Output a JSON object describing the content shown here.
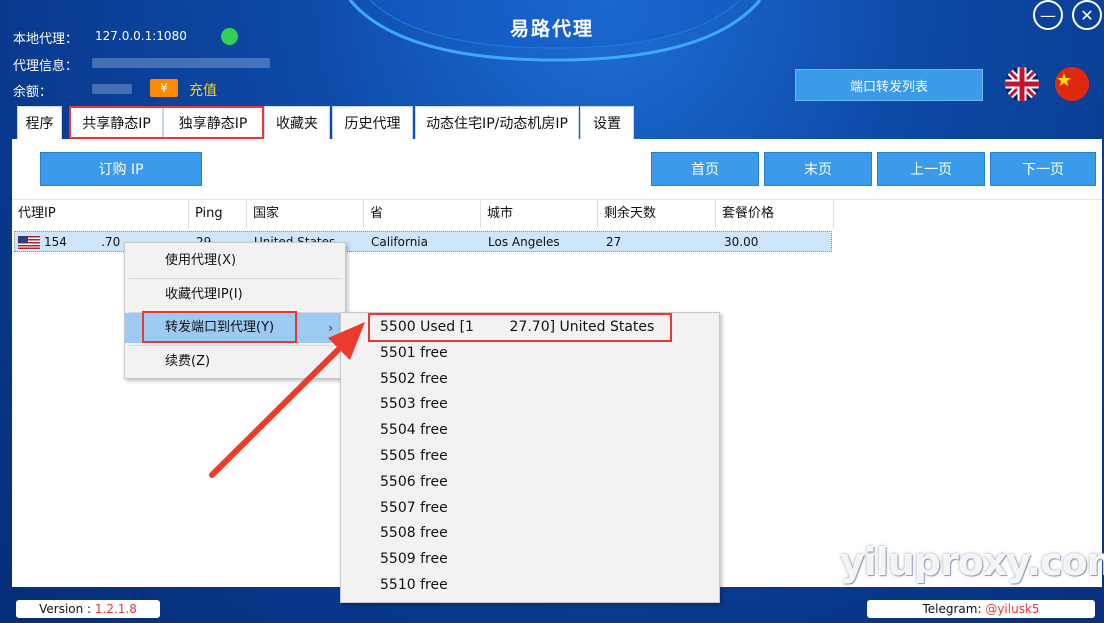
{
  "app": {
    "title": "易路代理",
    "local_proxy_label": "本地代理：",
    "local_proxy_value": "127.0.0.1:1080",
    "proxy_info_label": "代理信息：",
    "balance_label": "余额：",
    "recharge_label": "充值",
    "recharge_icon_glyph": "¥",
    "port_forward_list": "端口转发列表"
  },
  "colors": {
    "accent": "#3a9bea",
    "highlight": "#e53935",
    "status_online": "#31d158"
  },
  "tabs": [
    {
      "label": "程序"
    },
    {
      "label": "共享静态IP"
    },
    {
      "label": "独享静态IP"
    },
    {
      "label": "收藏夹"
    },
    {
      "label": "历史代理"
    },
    {
      "label": "动态住宅IP/动态机房IP"
    },
    {
      "label": "设置"
    }
  ],
  "toolbar": {
    "buy_ip": "订购 IP",
    "first_page": "首页",
    "last_page": "末页",
    "prev_page": "上一页",
    "next_page": "下一页"
  },
  "table": {
    "columns": [
      "代理IP",
      "Ping",
      "国家",
      "省",
      "城市",
      "剩余天数",
      "套餐价格"
    ],
    "rows": [
      {
        "ip": "154         .70",
        "ping": "29",
        "country": "United States",
        "province": "California",
        "city": "Los Angeles",
        "days_left": "27",
        "price": "30.00"
      }
    ]
  },
  "context_menu": {
    "items": [
      {
        "label": "使用代理(X)"
      },
      {
        "label": "收藏代理IP(I)"
      },
      {
        "label": "转发端口到代理(Y)",
        "arrow": "›"
      },
      {
        "label": "续费(Z)"
      }
    ]
  },
  "submenu": {
    "items": [
      "5500 Used [1        27.70] United States",
      "5501 free",
      "5502 free",
      "5503 free",
      "5504 free",
      "5505 free",
      "5506 free",
      "5507 free",
      "5508 free",
      "5509 free",
      "5510 free"
    ]
  },
  "statusbar": {
    "version_label": "Version :",
    "version_value": "1.2.1.8",
    "telegram_label": "Telegram:",
    "telegram_value": "@yilusk5"
  },
  "watermark": "yiluproxy.com",
  "window": {
    "minimize_glyph": "—",
    "close_glyph": "✕"
  }
}
